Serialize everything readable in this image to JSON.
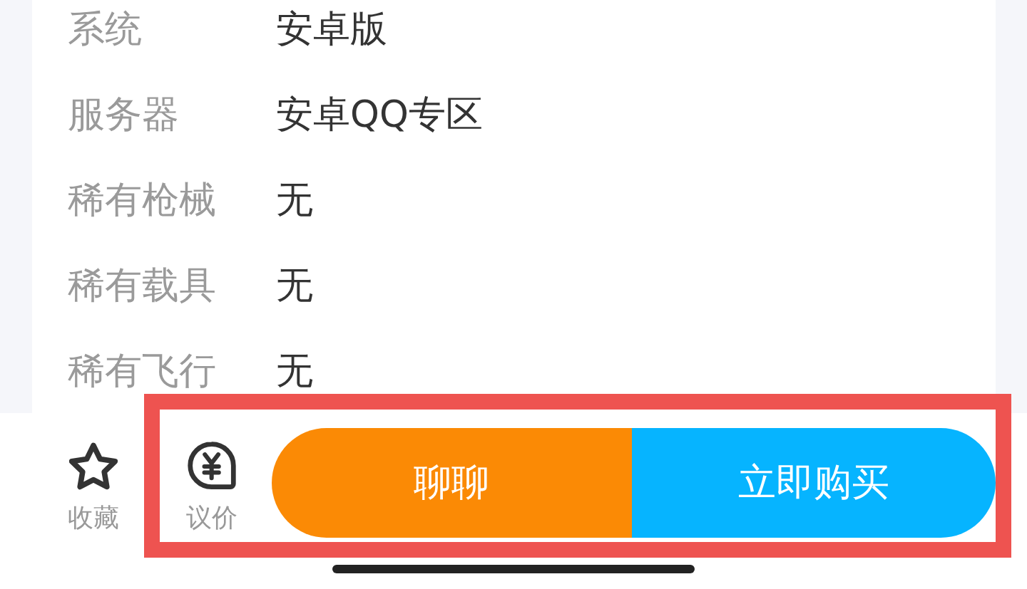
{
  "details": [
    {
      "label": "系统",
      "value": "安卓版"
    },
    {
      "label": "服务器",
      "value": "安卓QQ专区"
    },
    {
      "label": "稀有枪械",
      "value": "无"
    },
    {
      "label": "稀有载具",
      "value": "无"
    },
    {
      "label": "稀有飞行",
      "value": "无"
    }
  ],
  "bottom_bar": {
    "highlighted": true,
    "actions": [
      {
        "kind": "favorite",
        "label": "收藏"
      },
      {
        "kind": "bargain",
        "label": "议价"
      }
    ],
    "buttons": [
      {
        "kind": "chat",
        "label": "聊聊"
      },
      {
        "kind": "buy",
        "label": "立即购买"
      }
    ]
  }
}
